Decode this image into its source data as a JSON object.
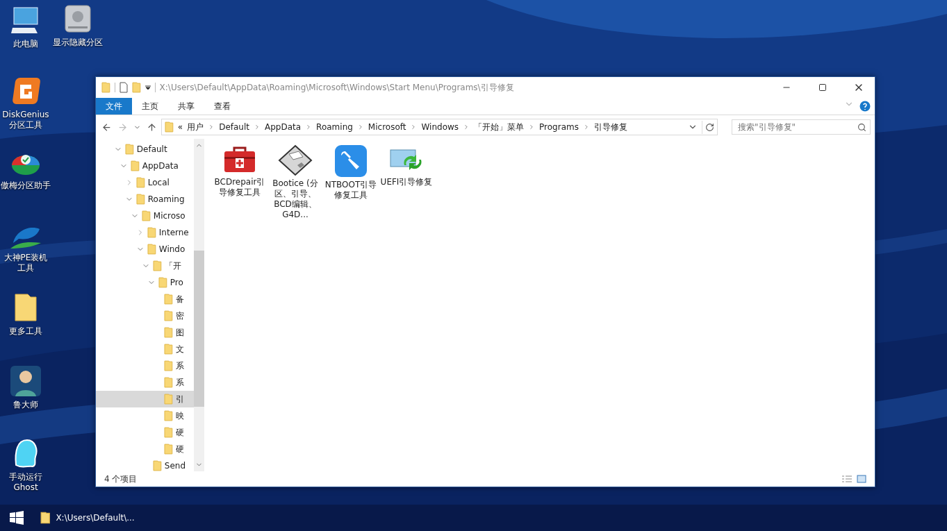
{
  "desktop": {
    "icons": [
      {
        "label": "此电脑"
      },
      {
        "label": "显示隐藏分区"
      },
      {
        "label": "DiskGenius分区工具"
      },
      {
        "label": "傲梅分区助手"
      },
      {
        "label": "大神PE装机工具"
      },
      {
        "label": "更多工具"
      },
      {
        "label": "鲁大师"
      },
      {
        "label": "手动运行Ghost"
      }
    ]
  },
  "window": {
    "title": "X:\\Users\\Default\\AppData\\Roaming\\Microsoft\\Windows\\Start Menu\\Programs\\引导修复",
    "ribbon_tabs": [
      {
        "label": "文件",
        "selected": true
      },
      {
        "label": "主页",
        "selected": false
      },
      {
        "label": "共享",
        "selected": false
      },
      {
        "label": "查看",
        "selected": false
      }
    ],
    "address": {
      "prefix": "«",
      "segments": [
        "用户",
        "Default",
        "AppData",
        "Roaming",
        "Microsoft",
        "Windows",
        "「开始」菜单",
        "Programs",
        "引导修复"
      ]
    },
    "search": {
      "placeholder": "搜索\"引导修复\""
    },
    "tree": [
      {
        "label": "Default",
        "expanded": true,
        "selected": false,
        "children": [
          {
            "label": "AppData",
            "expanded": true,
            "selected": false,
            "children": [
              {
                "label": "Local",
                "expanded": false,
                "selected": false
              },
              {
                "label": "Roaming",
                "expanded": true,
                "selected": false,
                "children": [
                  {
                    "label": "Microso",
                    "expanded": true,
                    "selected": false,
                    "children": [
                      {
                        "label": "Interne",
                        "expanded": false,
                        "selected": false
                      },
                      {
                        "label": "Windo",
                        "expanded": true,
                        "selected": false,
                        "children": [
                          {
                            "label": "「开",
                            "expanded": true,
                            "selected": false,
                            "children": [
                              {
                                "label": "Pro",
                                "expanded": true,
                                "selected": false,
                                "children": [
                                  {
                                    "label": "备",
                                    "selected": false
                                  },
                                  {
                                    "label": "密",
                                    "selected": false
                                  },
                                  {
                                    "label": "图",
                                    "selected": false
                                  },
                                  {
                                    "label": "文",
                                    "selected": false
                                  },
                                  {
                                    "label": "系",
                                    "selected": false
                                  },
                                  {
                                    "label": "系",
                                    "selected": false
                                  },
                                  {
                                    "label": "引",
                                    "selected": true
                                  },
                                  {
                                    "label": "映",
                                    "selected": false
                                  },
                                  {
                                    "label": "硬",
                                    "selected": false
                                  },
                                  {
                                    "label": "硬",
                                    "selected": false
                                  }
                                ]
                              }
                            ]
                          },
                          {
                            "label": "Send",
                            "selected": false
                          }
                        ]
                      }
                    ]
                  }
                ]
              }
            ]
          }
        ]
      }
    ],
    "files": [
      {
        "label": "BCDrepair引导修复工具"
      },
      {
        "label": "Bootice (分区、引导、BCD编辑、G4D..."
      },
      {
        "label": "NTBOOT引导修复工具"
      },
      {
        "label": "UEFI引导修复"
      }
    ],
    "status_bar": {
      "count": "4 个项目"
    }
  },
  "taskbar": {
    "tasks": [
      {
        "label": "X:\\Users\\Default\\..."
      }
    ]
  }
}
